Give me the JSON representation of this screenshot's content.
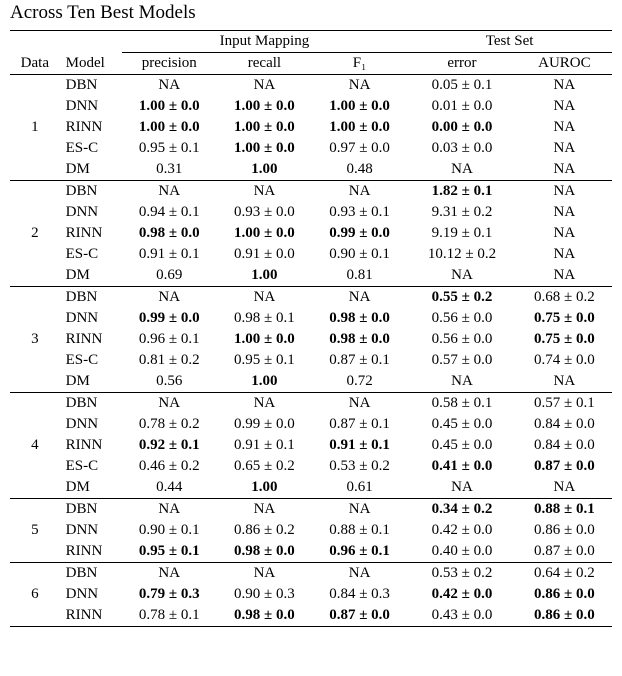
{
  "caption": "Across Ten Best Models",
  "headers": {
    "data": "Data",
    "model": "Model",
    "input_mapping": "Input Mapping",
    "test_set": "Test Set",
    "precision": "precision",
    "recall": "recall",
    "f1": "F₁",
    "error": "error",
    "auroc": "AUROC"
  },
  "groups": [
    {
      "data": "1",
      "rows": [
        {
          "model": "DBN",
          "precision": "NA",
          "recall": "NA",
          "f1": "NA",
          "error": "0.05 ± 0.1",
          "auroc": "NA",
          "b": {}
        },
        {
          "model": "DNN",
          "precision": "1.00 ± 0.0",
          "recall": "1.00 ± 0.0",
          "f1": "1.00 ± 0.0",
          "error": "0.01 ± 0.0",
          "auroc": "NA",
          "b": {
            "precision": true,
            "recall": true,
            "f1": true
          }
        },
        {
          "model": "RINN",
          "precision": "1.00 ± 0.0",
          "recall": "1.00 ± 0.0",
          "f1": "1.00 ± 0.0",
          "error": "0.00 ± 0.0",
          "auroc": "NA",
          "b": {
            "precision": true,
            "recall": true,
            "f1": true,
            "error": true
          }
        },
        {
          "model": "ES-C",
          "precision": "0.95 ± 0.1",
          "recall": "1.00 ± 0.0",
          "f1": "0.97 ± 0.0",
          "error": "0.03 ± 0.0",
          "auroc": "NA",
          "b": {
            "recall": true
          }
        },
        {
          "model": "DM",
          "precision": "0.31",
          "recall": "1.00",
          "f1": "0.48",
          "error": "NA",
          "auroc": "NA",
          "b": {
            "recall": true
          }
        }
      ]
    },
    {
      "data": "2",
      "rows": [
        {
          "model": "DBN",
          "precision": "NA",
          "recall": "NA",
          "f1": "NA",
          "error": "1.82 ± 0.1",
          "auroc": "NA",
          "b": {
            "error": true
          }
        },
        {
          "model": "DNN",
          "precision": "0.94 ± 0.1",
          "recall": "0.93 ± 0.0",
          "f1": "0.93 ± 0.1",
          "error": "9.31 ± 0.2",
          "auroc": "NA",
          "b": {}
        },
        {
          "model": "RINN",
          "precision": "0.98 ± 0.0",
          "recall": "1.00 ± 0.0",
          "f1": "0.99 ± 0.0",
          "error": "9.19 ± 0.1",
          "auroc": "NA",
          "b": {
            "precision": true,
            "recall": true,
            "f1": true
          }
        },
        {
          "model": "ES-C",
          "precision": "0.91 ± 0.1",
          "recall": "0.91 ± 0.0",
          "f1": "0.90 ± 0.1",
          "error": "10.12 ± 0.2",
          "auroc": "NA",
          "b": {}
        },
        {
          "model": "DM",
          "precision": "0.69",
          "recall": "1.00",
          "f1": "0.81",
          "error": "NA",
          "auroc": "NA",
          "b": {
            "recall": true
          }
        }
      ]
    },
    {
      "data": "3",
      "rows": [
        {
          "model": "DBN",
          "precision": "NA",
          "recall": "NA",
          "f1": "NA",
          "error": "0.55 ± 0.2",
          "auroc": "0.68 ± 0.2",
          "b": {
            "error": true
          }
        },
        {
          "model": "DNN",
          "precision": "0.99 ± 0.0",
          "recall": "0.98 ± 0.1",
          "f1": "0.98 ± 0.0",
          "error": "0.56 ± 0.0",
          "auroc": "0.75 ± 0.0",
          "b": {
            "precision": true,
            "f1": true,
            "auroc": true
          }
        },
        {
          "model": "RINN",
          "precision": "0.96 ± 0.1",
          "recall": "1.00 ± 0.0",
          "f1": "0.98 ± 0.0",
          "error": "0.56 ± 0.0",
          "auroc": "0.75 ± 0.0",
          "b": {
            "recall": true,
            "f1": true,
            "auroc": true
          }
        },
        {
          "model": "ES-C",
          "precision": "0.81 ± 0.2",
          "recall": "0.95 ± 0.1",
          "f1": "0.87 ± 0.1",
          "error": "0.57 ± 0.0",
          "auroc": "0.74 ± 0.0",
          "b": {}
        },
        {
          "model": "DM",
          "precision": "0.56",
          "recall": "1.00",
          "f1": "0.72",
          "error": "NA",
          "auroc": "NA",
          "b": {
            "recall": true
          }
        }
      ]
    },
    {
      "data": "4",
      "rows": [
        {
          "model": "DBN",
          "precision": "NA",
          "recall": "NA",
          "f1": "NA",
          "error": "0.58 ± 0.1",
          "auroc": "0.57 ± 0.1",
          "b": {}
        },
        {
          "model": "DNN",
          "precision": "0.78 ± 0.2",
          "recall": "0.99 ± 0.0",
          "f1": "0.87 ± 0.1",
          "error": "0.45 ± 0.0",
          "auroc": "0.84 ± 0.0",
          "b": {}
        },
        {
          "model": "RINN",
          "precision": "0.92 ± 0.1",
          "recall": "0.91 ± 0.1",
          "f1": "0.91 ± 0.1",
          "error": "0.45 ± 0.0",
          "auroc": "0.84 ± 0.0",
          "b": {
            "precision": true,
            "f1": true
          }
        },
        {
          "model": "ES-C",
          "precision": "0.46 ± 0.2",
          "recall": "0.65 ± 0.2",
          "f1": "0.53 ± 0.2",
          "error": "0.41 ± 0.0",
          "auroc": "0.87 ± 0.0",
          "b": {
            "error": true,
            "auroc": true
          }
        },
        {
          "model": "DM",
          "precision": "0.44",
          "recall": "1.00",
          "f1": "0.61",
          "error": "NA",
          "auroc": "NA",
          "b": {
            "recall": true
          }
        }
      ]
    },
    {
      "data": "5",
      "rows": [
        {
          "model": "DBN",
          "precision": "NA",
          "recall": "NA",
          "f1": "NA",
          "error": "0.34 ± 0.2",
          "auroc": "0.88 ± 0.1",
          "b": {
            "error": true,
            "auroc": true
          }
        },
        {
          "model": "DNN",
          "precision": "0.90 ± 0.1",
          "recall": "0.86 ± 0.2",
          "f1": "0.88 ± 0.1",
          "error": "0.42 ± 0.0",
          "auroc": "0.86 ± 0.0",
          "b": {}
        },
        {
          "model": "RINN",
          "precision": "0.95 ± 0.1",
          "recall": "0.98 ± 0.0",
          "f1": "0.96 ± 0.1",
          "error": "0.40 ± 0.0",
          "auroc": "0.87 ± 0.0",
          "b": {
            "precision": true,
            "recall": true,
            "f1": true
          }
        }
      ]
    },
    {
      "data": "6",
      "rows": [
        {
          "model": "DBN",
          "precision": "NA",
          "recall": "NA",
          "f1": "NA",
          "error": "0.53 ± 0.2",
          "auroc": "0.64 ± 0.2",
          "b": {}
        },
        {
          "model": "DNN",
          "precision": "0.79 ± 0.3",
          "recall": "0.90 ± 0.3",
          "f1": "0.84 ± 0.3",
          "error": "0.42 ± 0.0",
          "auroc": "0.86 ± 0.0",
          "b": {
            "precision": true,
            "error": true,
            "auroc": true
          }
        },
        {
          "model": "RINN",
          "precision": "0.78 ± 0.1",
          "recall": "0.98 ± 0.0",
          "f1": "0.87 ± 0.0",
          "error": "0.43 ± 0.0",
          "auroc": "0.86 ± 0.0",
          "b": {
            "recall": true,
            "f1": true,
            "auroc": true
          }
        }
      ]
    }
  ]
}
